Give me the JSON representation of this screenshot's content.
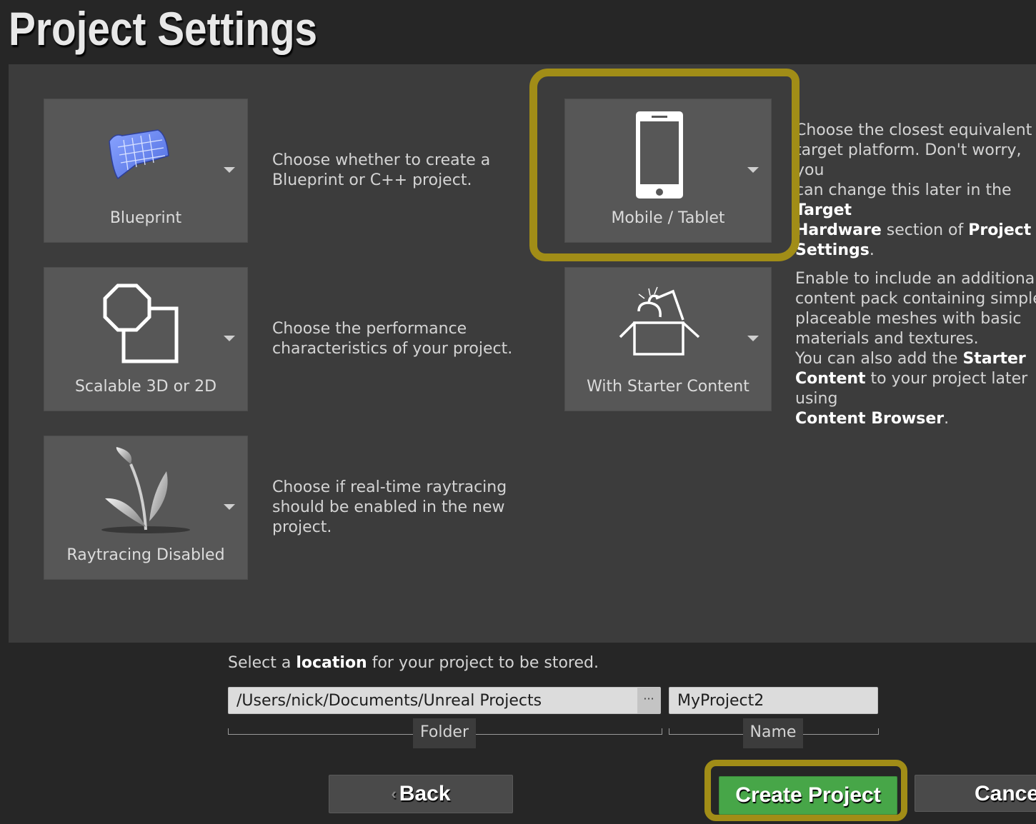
{
  "page": {
    "title": "Project Settings"
  },
  "options": {
    "blueprint": {
      "label": "Blueprint",
      "desc": "Choose whether to create a\nBlueprint or C++ project."
    },
    "scalable": {
      "label": "Scalable 3D or 2D",
      "desc": "Choose the performance\ncharacteristics of your project."
    },
    "raytracing": {
      "label": "Raytracing Disabled",
      "desc": "Choose if real-time raytracing\nshould be enabled in the new\nproject."
    },
    "mobile": {
      "label": "Mobile / Tablet",
      "desc_1": "Choose the closest equivalent\ntarget platform. Don't worry, you\ncan change this later in the ",
      "desc_bold_1": "Target\nHardware",
      "desc_2": " section of ",
      "desc_bold_2": "Project\nSettings",
      "desc_3": "."
    },
    "starter": {
      "label": "With Starter Content",
      "desc_1": "Enable to include an additional\ncontent pack containing simple\nplaceable meshes with basic\nmaterials and textures.\nYou can also add the ",
      "desc_bold_1": "Starter\nContent",
      "desc_2": " to your project later using\n",
      "desc_bold_2": "Content Browser",
      "desc_3": "."
    }
  },
  "location": {
    "prompt_1": "Select a ",
    "prompt_bold": "location",
    "prompt_2": " for your project to be stored.",
    "folder_value": "/Users/nick/Documents/Unreal Projects",
    "browse_label": "···",
    "name_value": "MyProject2",
    "folder_label": "Folder",
    "name_label": "Name"
  },
  "buttons": {
    "back": "Back",
    "create": "Create Project",
    "cancel": "Cancel"
  },
  "colors": {
    "create_button": "#47a648",
    "highlight": "#a18d17",
    "panel": "#3c3c3c",
    "tile": "#575757"
  }
}
